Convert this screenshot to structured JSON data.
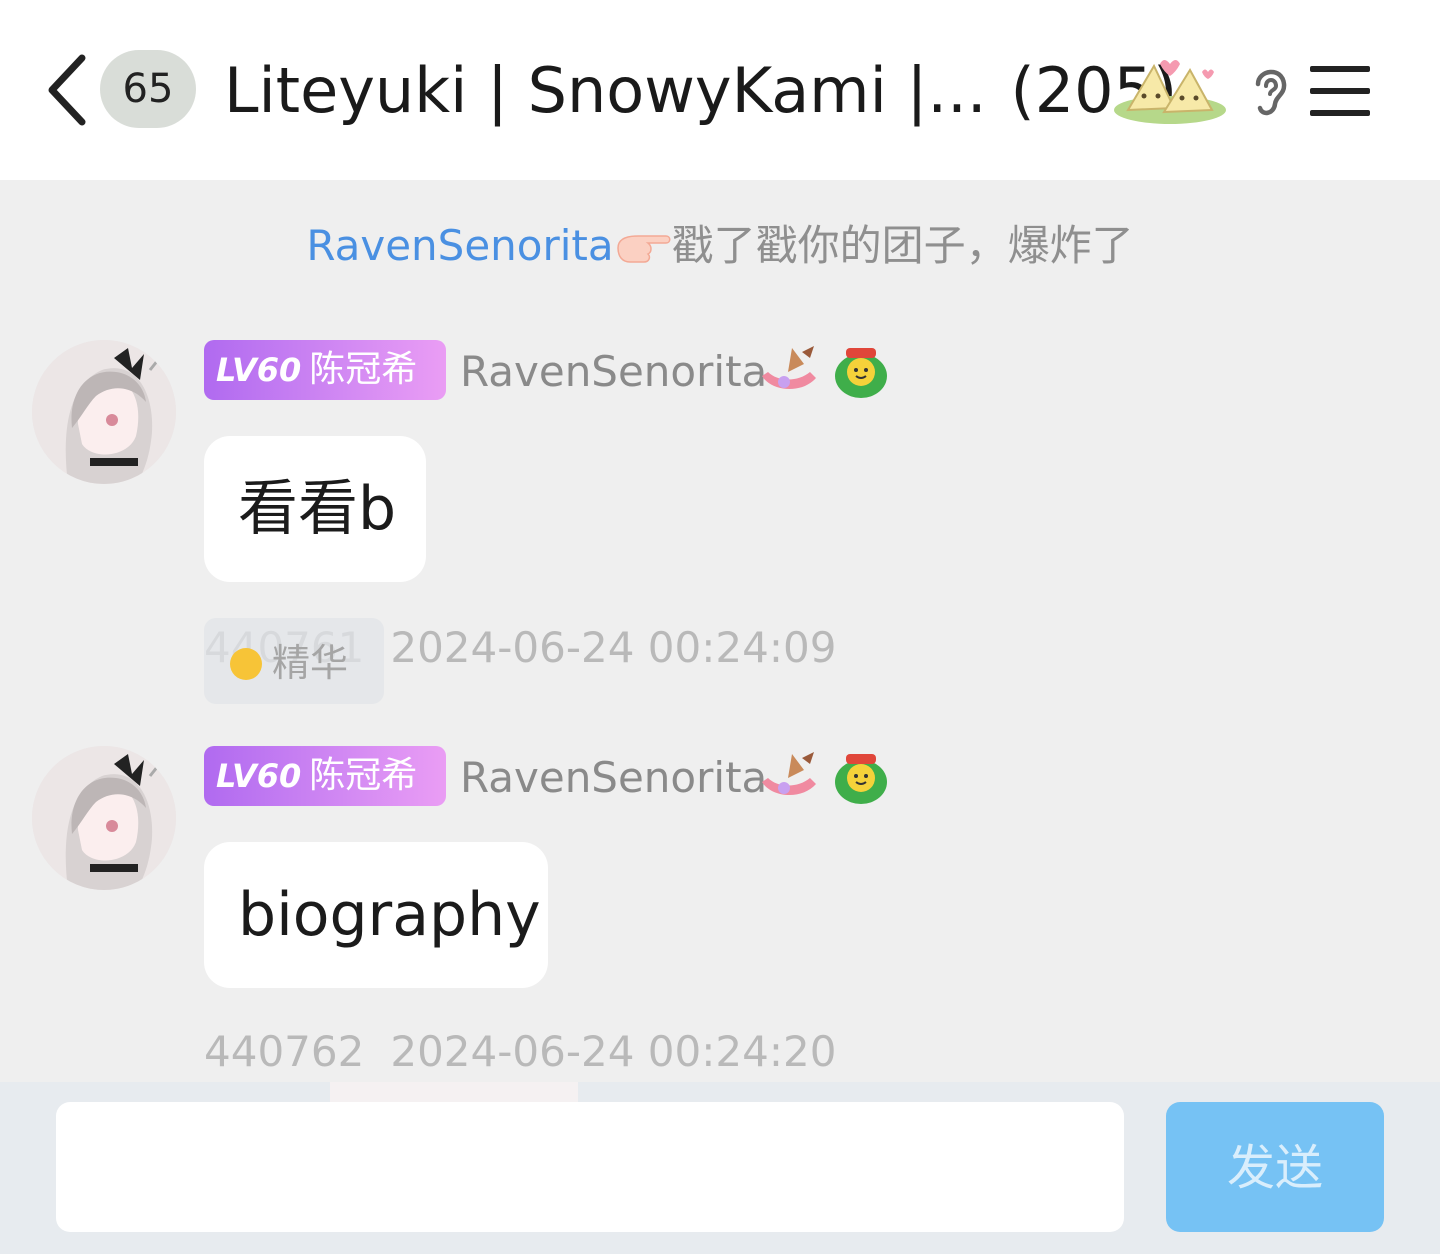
{
  "header": {
    "unread_count": "65",
    "title": "Liteyuki | SnowyKami |...",
    "member_count": "(205)",
    "icons": [
      "back-arrow-icon",
      "zongzi-sticker-icon",
      "ear-icon",
      "menu-icon"
    ]
  },
  "notice": {
    "nickname": "RavenSenorita",
    "text": "戳了戳你的团子，爆炸了",
    "icon": "pointing-hand-icon"
  },
  "messages": [
    {
      "level": "LV60",
      "title": "陈冠希",
      "sender": "RavenSenorita",
      "text": "看看b",
      "msg_id": "440761",
      "time": "2024-06-24 00:24:09",
      "essence_label": "精华"
    },
    {
      "level": "LV60",
      "title": "陈冠希",
      "sender": "RavenSenorita",
      "text": "biography",
      "msg_id": "440762",
      "time": "2024-06-24 00:24:20"
    }
  ],
  "input": {
    "placeholder": "",
    "send_label": "发送"
  },
  "colors": {
    "accent_link": "#4a90e2",
    "level_badge": "#c07df2",
    "send_button": "#76c2f4",
    "chat_background": "#efefef"
  }
}
